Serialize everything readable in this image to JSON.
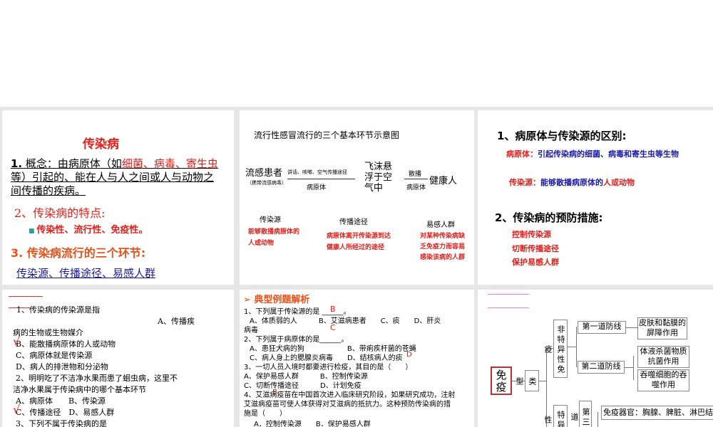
{
  "slide1": {
    "title": "传染病",
    "concept_num": "1.",
    "concept_a": " 概念：由病原体（如",
    "concept_red": "细菌、病毒、寄生虫",
    "concept_b": "等）引起的、能在人与人之间或人与动物之间传播的疾病。",
    "feature_title": "2、传染病的特点:",
    "features": "传染性、流行性、免疫性。",
    "links_title": "3. 传染病流行的三个环节:",
    "links": "传染源、传播途径、易感人群"
  },
  "slide2": {
    "title": "流行性感冒流行的三个基本环节示意图",
    "patient": "流感患者",
    "patient_note": "（携带流感病毒）",
    "arrow1_top": "讲话、咳嗽、空气传播途径",
    "arrow1_bottom": "病原体",
    "droplet": "飞沫悬浮于空气中",
    "arrow2_top": "散播",
    "arrow2_bottom": "病原体",
    "healthy": "健康人",
    "cols": [
      {
        "head": "传染源",
        "desc": "能够散播病原体的人或动物"
      },
      {
        "head": "传播途径",
        "desc": "病原体离开传染源到达健康人所经过的途径"
      },
      {
        "head": "易感人群",
        "desc": "对某种传染病缺乏免疫力而容易感染该病的人群"
      }
    ]
  },
  "slide3": {
    "h1": "1、病原体与传染源的区别:",
    "p1_label": "病原体：",
    "p1_text": "引起传染病的细菌、病毒和寄生虫等生物",
    "p2_label": "传染源：",
    "p2_text": "能够散播病原体的",
    "p2_red": "人或动物",
    "h2": "2、传染病的预防措施:",
    "measures": [
      "控制传染源",
      "切断传播途径",
      "保护易感人群"
    ]
  },
  "slide4": {
    "lines": [
      "1、传染病的传染源是指",
      "A、传播疾",
      "病的生物或生物媒介",
      "B、能散播病原体的人或动物",
      "C、病原体就是传染源",
      "D、病人的排泄物和分泌物",
      "2、明明吃了不洁净水果而患了蛔虫病，这里不",
      "洁净水果属于传染病中的哪个基本环节",
      "A、病原体　　B、传染源",
      "C、传播途径　D、易感人群",
      "3、下列不属于传染病的是"
    ],
    "check": "√"
  },
  "slide5": {
    "title": "典型例题解析",
    "lines": [
      "1、下列属于传染源的是 ______。",
      "A、体质弱的人　　　B、艾滋病患者　　C、痰　　D、肝炎",
      "病毒",
      "2、下列属于病原体的是______。",
      "A、患狂犬病的狗　　　　　　B、带痢疾杆菌的苍蝇",
      "C、病人身上的腮腺炎病毒　　D、结核病人的痰",
      "3、一切人员入境时都要进行检疫，其目的是（　　）",
      "A、保护易感人群　　　B、控制传染源",
      "C、切断传播途径　　　D、计划免疫",
      "4、艾滋病疫苗在中国首次进入临床研究阶段，如果研究成功，注射",
      "艾滋病疫苗可使人体获得对艾滋病的抵抗力。这种预防传染病的措",
      "施是（　　）",
      "A．控制传染源　　B．保护易感人群"
    ],
    "ans1": "B",
    "ans1b": "C",
    "ans2": "D",
    "ans4": "B"
  },
  "slide6": {
    "root": "免疫",
    "type": "类型",
    "nonspecific": "非特异性免疫",
    "line1": "第一道防线",
    "line1_desc": "皮肤和黏膜的屏障作用",
    "line2": "第二道防线",
    "line2_desc_a": "体液杀菌物质抗菌作用",
    "line2_desc_b": "吞噬细胞的吞噬作用",
    "specific": "特异性",
    "line3": "第三道",
    "organs": "免疫器官：胸腺、脾脏、淋巴结"
  },
  "colors": {
    "red": "#e0201c",
    "blue": "#1a1aa8",
    "pink": "#e080e0"
  }
}
